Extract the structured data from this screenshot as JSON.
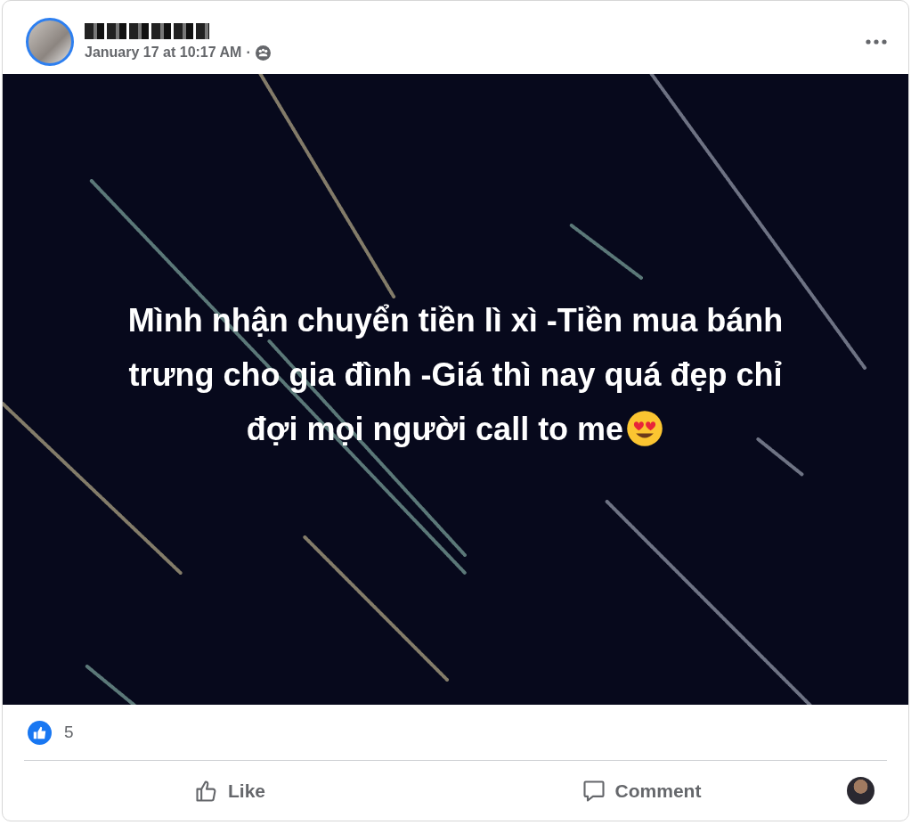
{
  "post": {
    "timestamp": "January 17 at 10:17 AM",
    "separator": "·",
    "message_lines": [
      "Mình nhận chuyển tiền lì xì -Tiền mua bánh",
      "trưng cho gia đình -Giá thì nay quá đẹp chỉ",
      "đợi mọi người call to me"
    ]
  },
  "reactions": {
    "count": "5"
  },
  "actions": [
    {
      "kind": "like",
      "label": "Like"
    },
    {
      "kind": "comment",
      "label": "Comment"
    }
  ]
}
